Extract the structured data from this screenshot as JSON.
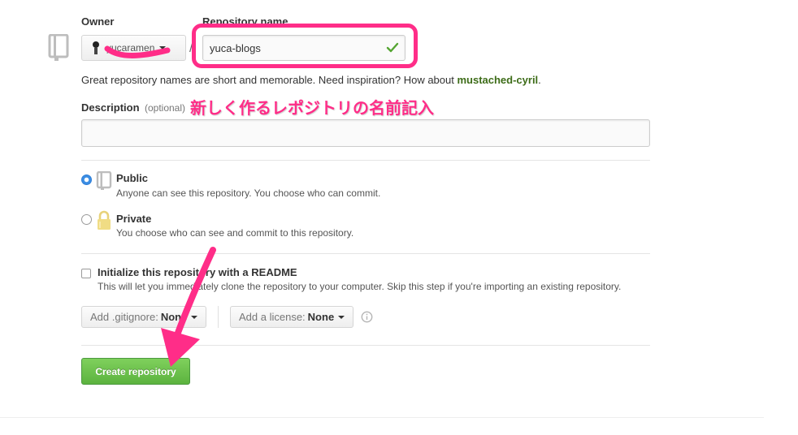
{
  "owner": {
    "label": "Owner",
    "username": "yucaramen"
  },
  "repo": {
    "label": "Repository name",
    "value": "yuca-blogs",
    "slash": "/"
  },
  "suggestion": {
    "text": "Great repository names are short and memorable. Need inspiration? How about ",
    "name": "mustached-cyril",
    "end": "."
  },
  "annotation": {
    "text": "新しく作るレポジトリの名前記入",
    "color": "#ff2d88"
  },
  "description": {
    "label": "Description",
    "optional": "(optional)",
    "value": ""
  },
  "visibility": {
    "public": {
      "title": "Public",
      "desc": "Anyone can see this repository. You choose who can commit.",
      "selected": true
    },
    "private": {
      "title": "Private",
      "desc": "You choose who can see and commit to this repository.",
      "selected": false
    }
  },
  "readme": {
    "title": "Initialize this repository with a README",
    "desc": "This will let you immediately clone the repository to your computer. Skip this step if you're importing an existing repository.",
    "checked": false
  },
  "gitignore": {
    "prefix": "Add .gitignore: ",
    "value": "None"
  },
  "license": {
    "prefix": "Add a license: ",
    "value": "None"
  },
  "create_button": {
    "label": "Create repository",
    "color": "#6cc644"
  },
  "icons": [
    "repo-book-icon",
    "avatar",
    "check-icon",
    "public-repo-icon",
    "lock-icon",
    "info-icon",
    "arrow-annotation"
  ]
}
